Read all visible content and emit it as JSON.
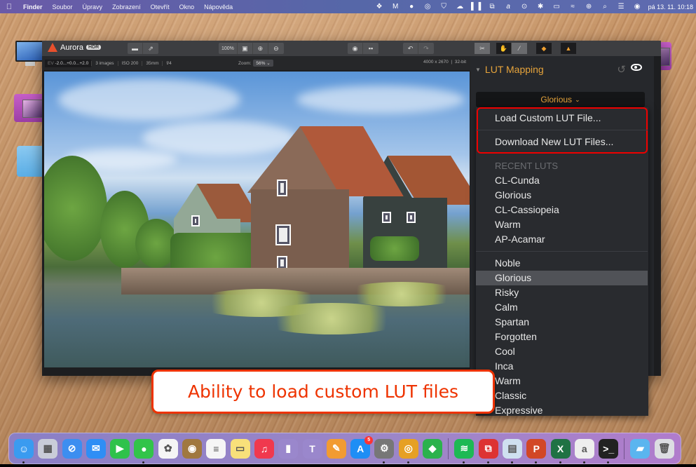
{
  "menubar": {
    "apple_icon": "apple-icon",
    "items": [
      "Finder",
      "Soubor",
      "Úpravy",
      "Zobrazení",
      "Otevřít",
      "Okno",
      "Nápověda"
    ],
    "status_icons": [
      "dropbox-icon",
      "malwarebytes-icon",
      "record-icon",
      "music-icon",
      "shield-icon",
      "cloud-icon",
      "sidebar-icon",
      "remote-icon",
      "signature-icon",
      "play-icon",
      "bluetooth-icon",
      "battery-icon",
      "wifi-icon",
      "user-icon",
      "search-icon",
      "control-center-icon",
      "siri-icon"
    ],
    "clock": "pá 13. 11.  10:18"
  },
  "app": {
    "name": "Aurora",
    "badge": "HDR",
    "toolbar": {
      "zoom_100": "100%",
      "buttons": [
        "open-icon",
        "share-icon",
        "zoom-100",
        "fit-screen-icon",
        "zoom-in-icon",
        "zoom-out-icon",
        "preview-eye-icon",
        "compare-icon",
        "undo-icon",
        "redo-icon",
        "crop-tool-icon",
        "hand-tool-icon",
        "brush-tool-icon",
        "layers-icon",
        "histogram-icon"
      ]
    },
    "infobar": {
      "ev_label": "EV",
      "ev_value": "-2.0...+0.0...+2.0",
      "images": "3 images",
      "iso": "ISO 200",
      "focal": "35mm",
      "aperture": "f/4",
      "zoom_label": "Zoom:",
      "zoom_value": "56%",
      "dimensions": "4000 x 2670",
      "bitdepth": "32-bit"
    }
  },
  "lut_panel": {
    "title": "LUT Mapping",
    "selected_lut": "Glorious",
    "menu": {
      "actions": [
        "Load Custom LUT File...",
        "Download New LUT Files..."
      ],
      "recent_header": "RECENT LUTS",
      "recent": [
        "CL-Cunda",
        "Glorious",
        "CL-Cassiopeia",
        "Warm",
        "AP-Acamar"
      ],
      "presets": [
        "Noble",
        "Glorious",
        "Risky",
        "Calm",
        "Spartan",
        "Forgotten",
        "Cool",
        "Inca",
        "Warm",
        "Classic",
        "Expressive"
      ],
      "selected_index": 1
    }
  },
  "callout": {
    "text": "Ability to load custom LUT files",
    "color": "#ee2200"
  },
  "dock": {
    "apps": [
      {
        "name": "finder",
        "glyph": "☺",
        "color": "#3a9bf0",
        "running": true
      },
      {
        "name": "launchpad",
        "glyph": "▦",
        "color": "#c9ccd8",
        "running": false
      },
      {
        "name": "safari",
        "glyph": "⊘",
        "color": "#3c8ef0",
        "running": false
      },
      {
        "name": "mail",
        "glyph": "✉",
        "color": "#2f8ef5",
        "running": false
      },
      {
        "name": "facetime",
        "glyph": "▶",
        "color": "#2fc24b",
        "running": false
      },
      {
        "name": "messages",
        "glyph": "●",
        "color": "#32c449",
        "running": true
      },
      {
        "name": "photos",
        "glyph": "✿",
        "color": "#f5f5f5",
        "running": false
      },
      {
        "name": "contacts",
        "glyph": "◉",
        "color": "#a07840",
        "running": false
      },
      {
        "name": "reminders",
        "glyph": "≡",
        "color": "#f5f5f5",
        "running": false
      },
      {
        "name": "notes",
        "glyph": "▭",
        "color": "#f8e07a",
        "running": false
      },
      {
        "name": "music",
        "glyph": "♫",
        "color": "#f0394e",
        "running": false
      },
      {
        "name": "numbers",
        "glyph": "▮",
        "color": "#9a87cc",
        "running": false
      },
      {
        "name": "keynote",
        "glyph": "T",
        "color": "#9a87cc",
        "running": false
      },
      {
        "name": "pages",
        "glyph": "✎",
        "color": "#f29b32",
        "running": false
      },
      {
        "name": "app-store",
        "glyph": "A",
        "color": "#1e8ef5",
        "running": false,
        "badge": "5"
      },
      {
        "name": "system-preferences",
        "glyph": "⚙",
        "color": "#777",
        "running": true
      },
      {
        "name": "chrome",
        "glyph": "◎",
        "color": "#e6a024",
        "running": true
      },
      {
        "name": "feedly",
        "glyph": "◆",
        "color": "#2bb24c",
        "running": false
      },
      {
        "name": "spotify",
        "glyph": "≋",
        "color": "#1db954",
        "running": true
      },
      {
        "name": "remote-desktop",
        "glyph": "⧉",
        "color": "#d33",
        "running": true
      },
      {
        "name": "preview",
        "glyph": "▤",
        "color": "#cfe0f0",
        "running": true
      },
      {
        "name": "powerpoint",
        "glyph": "P",
        "color": "#d24726",
        "running": true
      },
      {
        "name": "excel",
        "glyph": "X",
        "color": "#1f7244",
        "running": true
      },
      {
        "name": "signature",
        "glyph": "a",
        "color": "#eeeeee",
        "running": true
      },
      {
        "name": "terminal",
        "glyph": ">_",
        "color": "#222",
        "running": true
      },
      {
        "name": "downloads-folder",
        "glyph": "▰",
        "color": "#5ab5ef",
        "running": false
      },
      {
        "name": "trash",
        "glyph": "🗑",
        "color": "#dcdde2",
        "running": false
      }
    ]
  }
}
